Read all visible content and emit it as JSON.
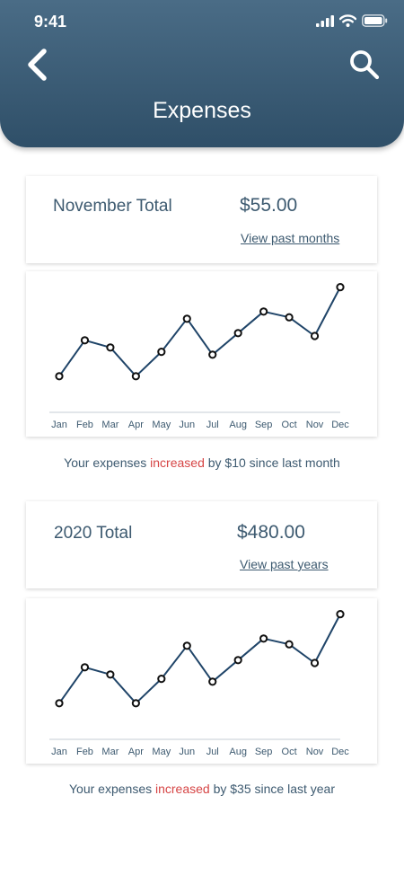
{
  "status": {
    "time": "9:41"
  },
  "header": {
    "title": "Expenses",
    "back_icon": "chevron-left-icon",
    "search_icon": "search-icon"
  },
  "colors": {
    "header_top": "#4a6c86",
    "header_bottom": "#2f4f68",
    "text": "#3d5a70",
    "accent_red": "#d64545",
    "line": "#1f4468"
  },
  "monthly": {
    "label": "November Total",
    "amount": "$55.00",
    "link": "View past months",
    "summary_prefix": "Your expenses ",
    "summary_highlight": "increased",
    "summary_suffix": " by $10 since last month"
  },
  "yearly": {
    "label": "2020 Total",
    "amount": "$480.00",
    "link": "View past years",
    "summary_prefix": "Your expenses ",
    "summary_highlight": "increased",
    "summary_suffix": " by $35 since last year"
  },
  "chart_data": [
    {
      "type": "line",
      "categories": [
        "Jan",
        "Feb",
        "Mar",
        "Apr",
        "May",
        "Jun",
        "Jul",
        "Aug",
        "Sep",
        "Oct",
        "Nov",
        "Dec"
      ],
      "values": [
        12,
        37,
        32,
        12,
        29,
        52,
        27,
        42,
        57,
        53,
        40,
        74
      ],
      "ylim": [
        0,
        80
      ],
      "grid": false
    },
    {
      "type": "line",
      "categories": [
        "Jan",
        "Feb",
        "Mar",
        "Apr",
        "May",
        "Jun",
        "Jul",
        "Aug",
        "Sep",
        "Oct",
        "Nov",
        "Dec"
      ],
      "values": [
        12,
        37,
        32,
        12,
        29,
        52,
        27,
        42,
        57,
        53,
        40,
        74
      ],
      "ylim": [
        0,
        80
      ],
      "grid": false
    }
  ]
}
